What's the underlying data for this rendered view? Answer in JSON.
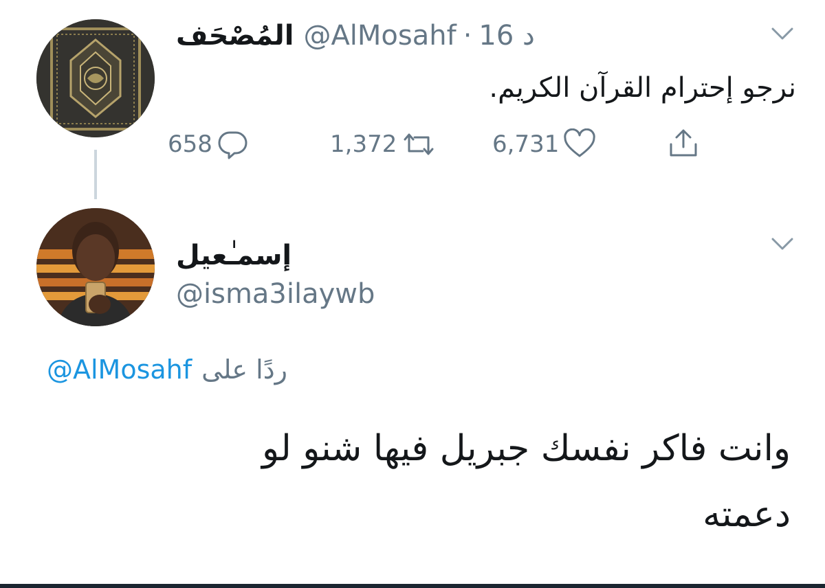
{
  "tweet": {
    "display_name": "المُصْحَف",
    "handle": "@AlMosahf",
    "separator": "·",
    "time": "16 د",
    "text": "نرجو إحترام القرآن الكريم.",
    "actions": {
      "replies": "658",
      "retweets": "1,372",
      "likes": "6,731"
    }
  },
  "reply": {
    "display_name": "إسمـٰعيل",
    "handle": "@isma3ilaywb",
    "replying_to_label": "ردًا على",
    "replying_to_handle": "@AlMosahf",
    "text_line1": "وانت فاكر نفسك جبريل فيها شنو لو",
    "text_line2": "دعمته"
  },
  "colors": {
    "link": "#1b95e0",
    "meta": "#657786",
    "chevron": "#8899a6",
    "text": "#14171a"
  },
  "icons": [
    "chevron-down-icon",
    "reply-icon",
    "retweet-icon",
    "like-icon",
    "share-icon"
  ]
}
